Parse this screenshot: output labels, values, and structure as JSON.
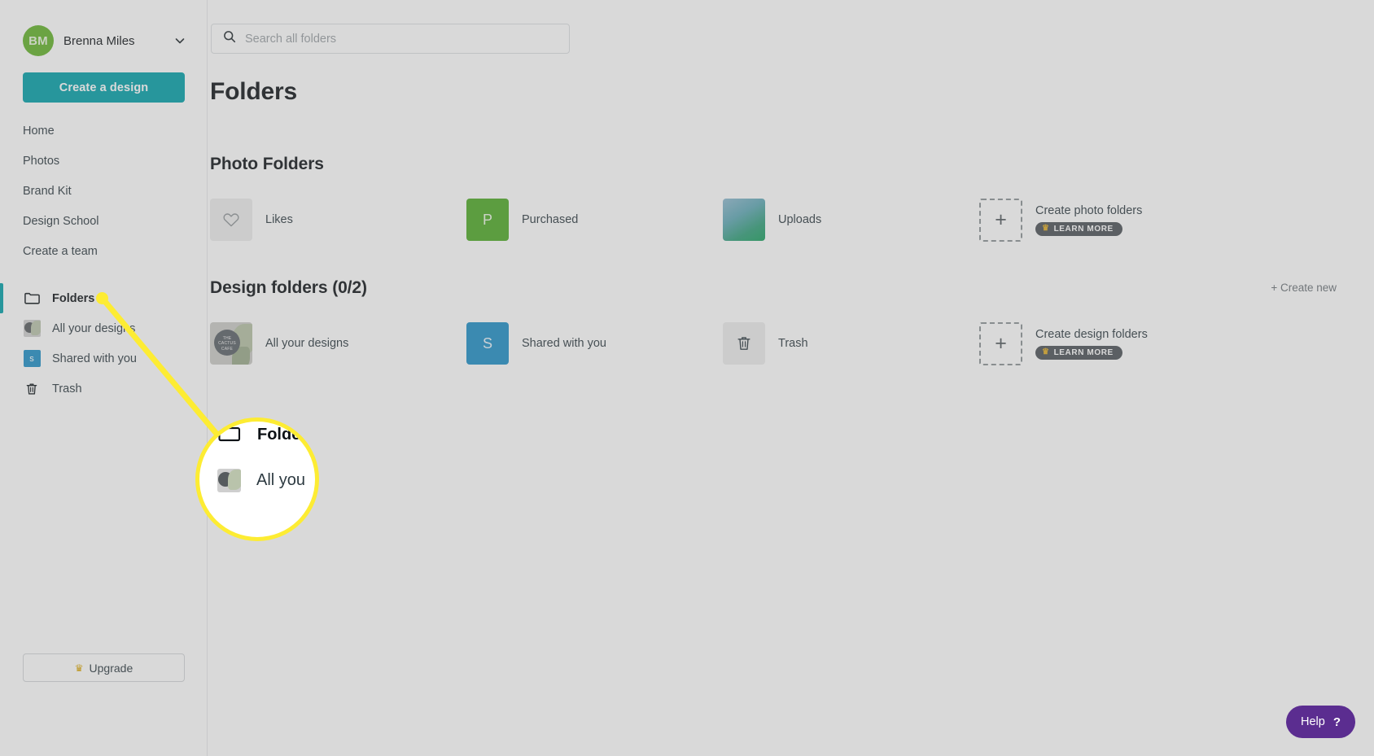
{
  "sidebar": {
    "account": {
      "initials": "BM",
      "name": "Brenna Miles",
      "chevron_icon": "chevron-down-icon"
    },
    "create_design_label": "Create a design",
    "primary_items": [
      {
        "label": "Home"
      },
      {
        "label": "Photos"
      },
      {
        "label": "Brand Kit"
      },
      {
        "label": "Design School"
      },
      {
        "label": "Create a team"
      }
    ],
    "secondary_items": [
      {
        "label": "Folders",
        "icon": "folder-icon",
        "active": true
      },
      {
        "label": "All your designs",
        "icon": "design-thumbnail-icon",
        "active": false
      },
      {
        "label": "Shared with you",
        "icon": "s-badge-icon",
        "active": false
      },
      {
        "label": "Trash",
        "icon": "trash-icon",
        "active": false
      }
    ],
    "upgrade_label": "Upgrade",
    "upgrade_icon": "crown-icon"
  },
  "search": {
    "placeholder": "Search all folders",
    "value": "",
    "icon": "search-icon"
  },
  "main": {
    "page_title": "Folders",
    "sections": [
      {
        "heading": "Photo Folders",
        "create_new_label": "",
        "cards": [
          {
            "label": "Likes",
            "icon": "heart-icon",
            "tile": "grey"
          },
          {
            "label": "Purchased",
            "icon": "letter-p-icon",
            "tile": "green",
            "glyph": "P"
          },
          {
            "label": "Uploads",
            "icon": "photo-gradient-icon",
            "tile": "photo"
          },
          {
            "label": "Create photo folders",
            "icon": "plus-icon",
            "tile": "dashed",
            "badge": "LEARN MORE",
            "badge_icon": "crown-icon"
          }
        ]
      },
      {
        "heading": "Design folders (0/2)",
        "create_new_label": "+ Create new",
        "cards": [
          {
            "label": "All your designs",
            "icon": "cactus-thumbnail-icon",
            "tile": "cactus"
          },
          {
            "label": "Shared with you",
            "icon": "letter-s-icon",
            "tile": "blue",
            "glyph": "S"
          },
          {
            "label": "Trash",
            "icon": "trash-icon",
            "tile": "grey"
          },
          {
            "label": "Create design folders",
            "icon": "plus-icon",
            "tile": "dashed",
            "badge": "LEARN MORE",
            "badge_icon": "crown-icon"
          }
        ]
      }
    ]
  },
  "callout": {
    "magnified_primary_label": "Folders",
    "magnified_secondary_label": "All you",
    "highlight_color": "#FDEC33"
  },
  "help": {
    "label": "Help",
    "question_mark": "?",
    "color": "#5B2D90"
  }
}
